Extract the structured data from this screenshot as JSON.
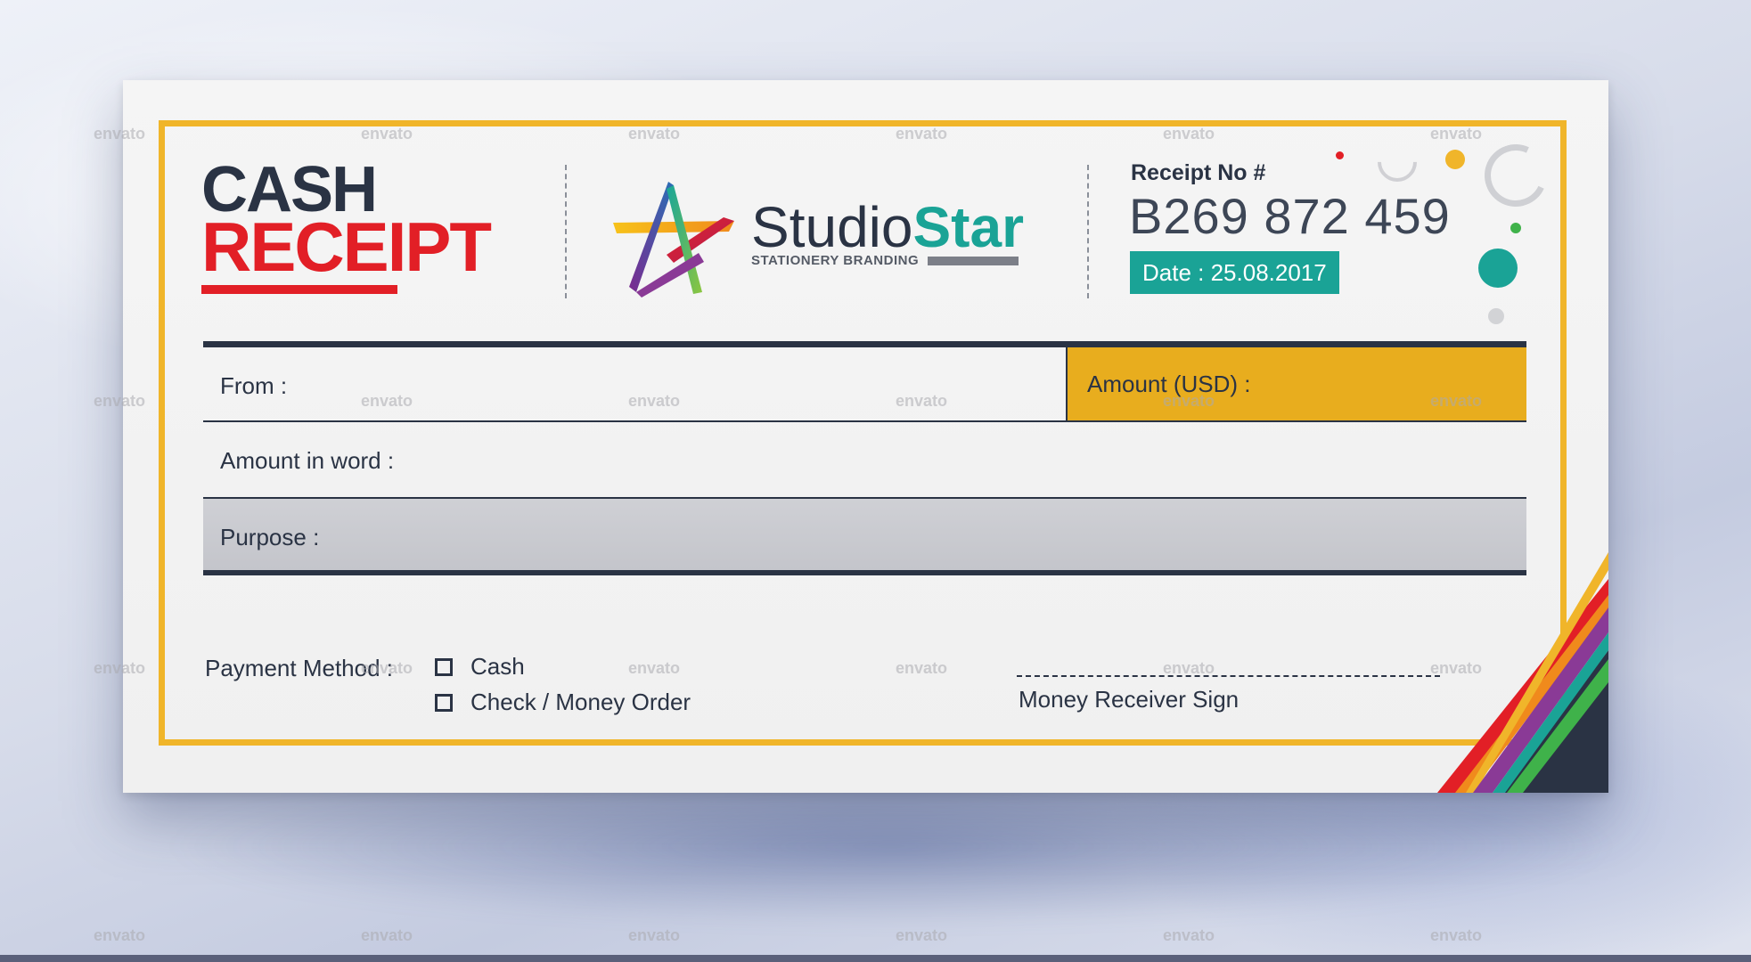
{
  "receipt": {
    "title_line1": "CASH",
    "title_line2": "RECEIPT",
    "brand": {
      "name_part1": "Studio",
      "name_part2": "Star",
      "tagline": "STATIONERY BRANDING"
    },
    "receipt_no_label": "Receipt No #",
    "receipt_no": "B269 872 459",
    "date": "Date : 25.08.2017"
  },
  "form": {
    "from_label": "From :",
    "amount_label": "Amount (USD) :",
    "amount_in_word_label": "Amount in word :",
    "purpose_label": "Purpose :",
    "payment_method_label": "Payment Method :",
    "payment_options": [
      "Cash",
      "Check / Money Order"
    ],
    "sign_label": "Money Receiver Sign"
  },
  "watermark": "envato",
  "colors": {
    "brand_red": "#e21f26",
    "brand_navy": "#2a3344",
    "brand_teal": "#1aa396",
    "border_yellow": "#f0b52a",
    "amount_yellow": "#e8ad1e",
    "purpose_gray": "#c9cacf"
  }
}
